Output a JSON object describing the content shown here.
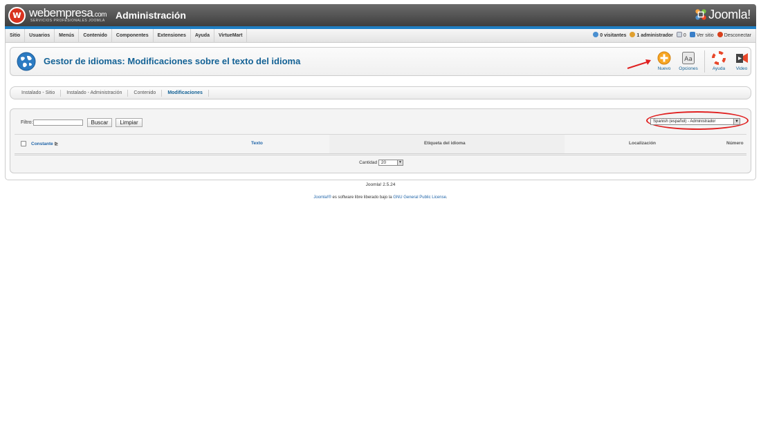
{
  "header": {
    "logo_text": "webempresa",
    "logo_suffix": ".com",
    "logo_sub": "SERVICIOS PROFESIONALES JOOMLA",
    "admin_title": "Administración",
    "joomla_text": "Joomla!"
  },
  "menu": [
    "Sitio",
    "Usuarios",
    "Menús",
    "Contenido",
    "Componentes",
    "Extensiones",
    "Ayuda",
    "VirtueMart"
  ],
  "status": {
    "visitors": "0 visitantes",
    "admins": "1 administrador",
    "messages": "0",
    "view_site": "Ver sitio",
    "logout": "Desconectar"
  },
  "toolbar": {
    "title": "Gestor de idiomas: Modificaciones sobre el texto del idioma",
    "nuevo": "Nuevo",
    "opciones": "Opciones",
    "ayuda": "Ayuda",
    "video": "Video"
  },
  "tabs": [
    "Instalado - Sitio",
    "Instalado - Administración",
    "Contenido",
    "Modificaciones"
  ],
  "active_tab": "Modificaciones",
  "filter": {
    "label": "Filtro:",
    "value": "",
    "search_button": "Buscar",
    "clear_button": "Limpiar",
    "language_selected": "Spanish (español) - Administrador"
  },
  "table": {
    "columns": [
      "Constante",
      "Texto",
      "Etiqueta del idioma",
      "Localización",
      "Número"
    ]
  },
  "pager": {
    "label": "Cantidad",
    "value": "20"
  },
  "footer": {
    "version": "Joomla! 2.5.24",
    "license_link1": "Joomla!®",
    "license_text": " es software libre liberado bajo la ",
    "license_link2": "GNU General Public License",
    "license_end": "."
  },
  "colors": {
    "accent": "#1f7fc4",
    "title": "#146295",
    "annotation": "#e02020"
  }
}
